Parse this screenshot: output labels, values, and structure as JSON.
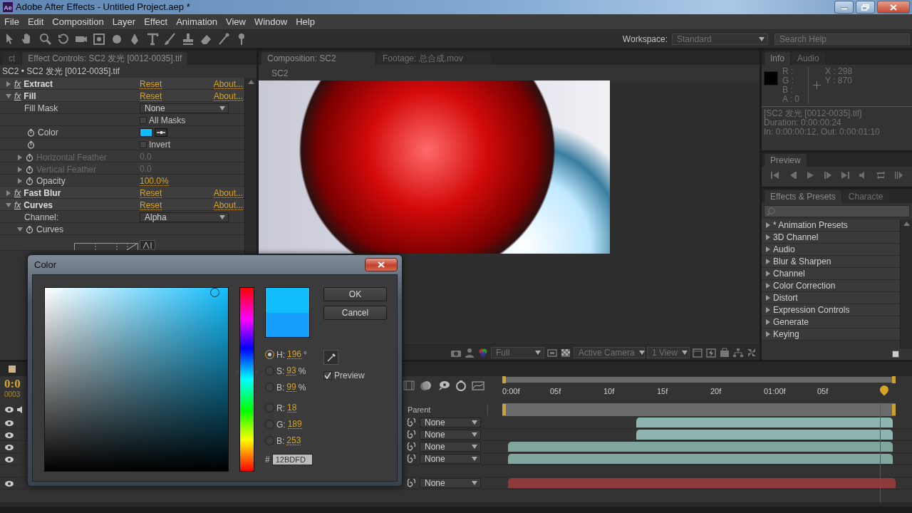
{
  "window": {
    "title": "Adobe After Effects - Untitled Project.aep *",
    "app_icon": "Ae"
  },
  "menu": [
    "File",
    "Edit",
    "Composition",
    "Layer",
    "Effect",
    "Animation",
    "View",
    "Window",
    "Help"
  ],
  "toolbar": {
    "workspace_label": "Workspace:",
    "workspace": "Standard",
    "search_placeholder": "Search Help"
  },
  "effect_controls": {
    "tabs": [
      {
        "label": "ct",
        "selected": false
      },
      {
        "label": "Effect Controls: SC2 发光 [0012-0035].tif",
        "selected": true
      }
    ],
    "header": "SC2 • SC2 发光 [0012-0035].tif",
    "rows": [
      {
        "kind": "effect",
        "badge": "fx",
        "label": "Extract",
        "expanded": false,
        "reset": "Reset",
        "about": "About..."
      },
      {
        "kind": "effect",
        "badge": "fx",
        "label": "Fill",
        "expanded": true,
        "reset": "Reset",
        "about": "About..."
      },
      {
        "kind": "dropdown",
        "label": "Fill Mask",
        "value": "None"
      },
      {
        "kind": "checkbox",
        "stopwatch": false,
        "text": "All Masks",
        "checked": false
      },
      {
        "kind": "color",
        "label": "Color",
        "stopwatch": true,
        "color": "#12bdfd"
      },
      {
        "kind": "checkbox",
        "stopwatch": true,
        "text": "Invert",
        "checked": false
      },
      {
        "kind": "value",
        "label": "Horizontal Feather",
        "stopwatch": true,
        "expanded": false,
        "value": "0.0",
        "disabled": true
      },
      {
        "kind": "value",
        "label": "Vertical Feather",
        "stopwatch": true,
        "expanded": false,
        "value": "0.0",
        "disabled": true
      },
      {
        "kind": "value",
        "label": "Opacity",
        "stopwatch": true,
        "expanded": false,
        "value": "100.0%",
        "disabled": false
      },
      {
        "kind": "effect",
        "badge": "fx",
        "label": "Fast Blur",
        "expanded": false,
        "reset": "Reset",
        "about": "About..."
      },
      {
        "kind": "effect",
        "badge": "fx",
        "label": "Curves",
        "expanded": true,
        "reset": "Reset",
        "about": "About..."
      },
      {
        "kind": "dropdown",
        "label": "Channel:",
        "value": "Alpha"
      },
      {
        "kind": "group",
        "label": "Curves",
        "stopwatch": true,
        "expanded": true
      },
      {
        "kind": "graph"
      }
    ]
  },
  "composition": {
    "tabs": [
      {
        "label": "Composition: SC2",
        "selected": true
      },
      {
        "label": "Footage: 总合成.mov",
        "selected": false
      }
    ],
    "subtab": "SC2",
    "resolution": "Full",
    "camera": "Active Camera",
    "views": "1 View"
  },
  "info": {
    "tabs": [
      {
        "label": "Info",
        "selected": true
      },
      {
        "label": "Audio",
        "selected": false
      }
    ],
    "channels": [
      "R :",
      "G :",
      "B :",
      "A : 0"
    ],
    "coords": [
      "X : 298",
      "Y : 870"
    ],
    "lines": [
      "[SC2 发光 [0012-0035].tif]",
      "Duration: 0:00:00:24",
      "In: 0:00:00:12, Out: 0:00:01:10"
    ]
  },
  "preview": {
    "tabs": [
      {
        "label": "Preview",
        "selected": true
      }
    ]
  },
  "effects_presets": {
    "tabs": [
      {
        "label": "Effects & Presets",
        "selected": true
      },
      {
        "label": "Characte",
        "selected": false
      }
    ],
    "items": [
      "* Animation Presets",
      "3D Channel",
      "Audio",
      "Blur & Sharpen",
      "Channel",
      "Color Correction",
      "Distort",
      "Expression Controls",
      "Generate",
      "Keying"
    ]
  },
  "timeline": {
    "time": "0:0",
    "frame": "0003",
    "parent_header": "Parent",
    "ruler": [
      "0:00f",
      "05f",
      "10f",
      "15f",
      "20f",
      "01:00f",
      "05f"
    ],
    "playhead": {
      "level": 0.97
    },
    "layers": [
      {
        "kind": "footage_trimmed",
        "visible": true,
        "parent": "None"
      },
      {
        "kind": "footage_trimmed",
        "visible": true,
        "parent": "None"
      },
      {
        "kind": "footage",
        "visible": true,
        "parent": "None"
      },
      {
        "kind": "footage",
        "visible": true,
        "parent": "None"
      },
      {
        "kind": "gap"
      },
      {
        "kind": "solid",
        "visible": true,
        "parent": "None"
      }
    ]
  },
  "color_dialog": {
    "title": "Color",
    "buttons": [
      "OK",
      "Cancel"
    ],
    "hue": {
      "level": 0.54
    },
    "swatches": [
      {
        "color": "#12bdfd"
      },
      {
        "color": "#17a0fb"
      }
    ],
    "fields": [
      {
        "label": "H:",
        "value": "196",
        "unit": "°",
        "selected": true
      },
      {
        "label": "S:",
        "value": "93",
        "unit": "%",
        "selected": false
      },
      {
        "label": "B:",
        "value": "99",
        "unit": "%",
        "selected": false
      },
      {
        "label": "R:",
        "value": "18",
        "selected": false
      },
      {
        "label": "G:",
        "value": "189",
        "selected": false
      },
      {
        "label": "B:",
        "value": "253",
        "selected": false
      }
    ],
    "hex_label": "#",
    "hex": "12BDFD",
    "preview": {
      "label": "Preview",
      "checked": true
    }
  }
}
